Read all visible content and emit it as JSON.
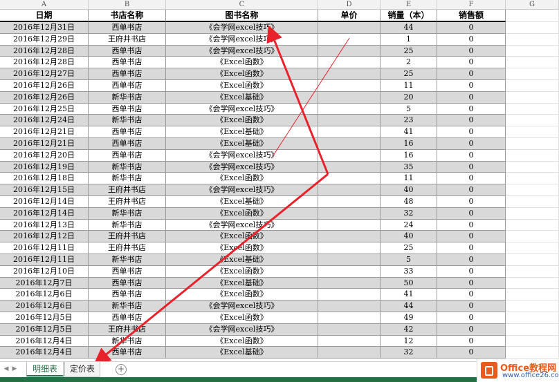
{
  "column_letters": [
    "A",
    "B",
    "C",
    "D",
    "E",
    "F",
    "G"
  ],
  "headers": [
    "日期",
    "书店名称",
    "图书名称",
    "单价",
    "销量（本）",
    "销售额",
    ""
  ],
  "rows": [
    [
      "2016年12月31日",
      "西单书店",
      "《会学网excel技巧》",
      "",
      "44",
      "0"
    ],
    [
      "2016年12月29日",
      "王府井书店",
      "《会学网excel技巧》",
      "",
      "1",
      "0"
    ],
    [
      "2016年12月28日",
      "西单书店",
      "《会学网excel技巧》",
      "",
      "25",
      "0"
    ],
    [
      "2016年12月28日",
      "西单书店",
      "《Excel函数》",
      "",
      "2",
      "0"
    ],
    [
      "2016年12月27日",
      "西单书店",
      "《Excel函数》",
      "",
      "25",
      "0"
    ],
    [
      "2016年12月26日",
      "西单书店",
      "《Excel函数》",
      "",
      "11",
      "0"
    ],
    [
      "2016年12月26日",
      "新华书店",
      "《Excel基础》",
      "",
      "20",
      "0"
    ],
    [
      "2016年12月25日",
      "西单书店",
      "《会学网excel技巧》",
      "",
      "5",
      "0"
    ],
    [
      "2016年12月24日",
      "新华书店",
      "《Excel函数》",
      "",
      "23",
      "0"
    ],
    [
      "2016年12月21日",
      "西单书店",
      "《Excel基础》",
      "",
      "41",
      "0"
    ],
    [
      "2016年12月21日",
      "西单书店",
      "《Excel基础》",
      "",
      "16",
      "0"
    ],
    [
      "2016年12月20日",
      "西单书店",
      "《会学网excel技巧》",
      "",
      "16",
      "0"
    ],
    [
      "2016年12月19日",
      "新华书店",
      "《会学网excel技巧》",
      "",
      "35",
      "0"
    ],
    [
      "2016年12月18日",
      "新华书店",
      "《Excel函数》",
      "",
      "11",
      "0"
    ],
    [
      "2016年12月15日",
      "王府井书店",
      "《会学网excel技巧》",
      "",
      "40",
      "0"
    ],
    [
      "2016年12月14日",
      "王府井书店",
      "《Excel基础》",
      "",
      "48",
      "0"
    ],
    [
      "2016年12月14日",
      "新华书店",
      "《Excel函数》",
      "",
      "32",
      "0"
    ],
    [
      "2016年12月13日",
      "新华书店",
      "《会学网excel技巧》",
      "",
      "24",
      "0"
    ],
    [
      "2016年12月12日",
      "王府井书店",
      "《Excel函数》",
      "",
      "40",
      "0"
    ],
    [
      "2016年12月11日",
      "王府井书店",
      "《Excel函数》",
      "",
      "25",
      "0"
    ],
    [
      "2016年12月11日",
      "新华书店",
      "《Excel基础》",
      "",
      "5",
      "0"
    ],
    [
      "2016年12月10日",
      "西单书店",
      "《Excel函数》",
      "",
      "33",
      "0"
    ],
    [
      "2016年12月7日",
      "西单书店",
      "《Excel基础》",
      "",
      "50",
      "0"
    ],
    [
      "2016年12月6日",
      "西单书店",
      "《Excel函数》",
      "",
      "41",
      "0"
    ],
    [
      "2016年12月6日",
      "新华书店",
      "《会学网excel技巧》",
      "",
      "44",
      "0"
    ],
    [
      "2016年12月5日",
      "西单书店",
      "《Excel函数》",
      "",
      "49",
      "0"
    ],
    [
      "2016年12月5日",
      "王府井书店",
      "《会学网excel技巧》",
      "",
      "42",
      "0"
    ],
    [
      "2016年12月4日",
      "新华书店",
      "《Excel函数》",
      "",
      "12",
      "0"
    ],
    [
      "2016年12月4日",
      "西单书店",
      "《Excel基础》",
      "",
      "32",
      "0"
    ]
  ],
  "sheet_tabs": [
    "明细表",
    "定价表"
  ],
  "active_tab": "明细表",
  "add_sheet_label": "+",
  "nav_arrows": [
    "◀",
    "▶"
  ],
  "brand": {
    "name": "Office教程网",
    "url": "www.office26.com"
  },
  "colors": {
    "row_gray": "#d9d9d9",
    "annotation_red": "#e8222b",
    "status_green": "#217346"
  }
}
